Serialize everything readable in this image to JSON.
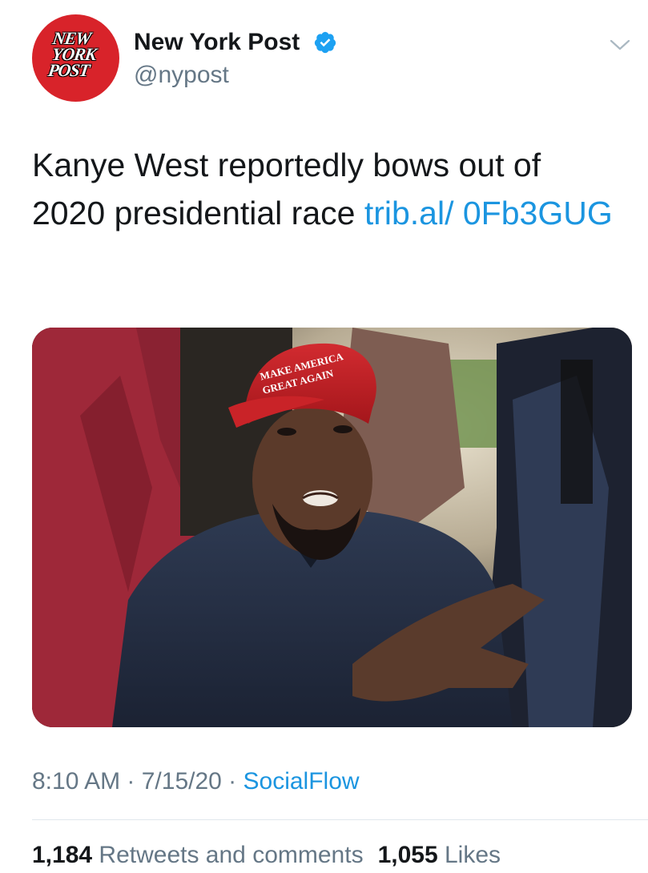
{
  "account": {
    "logo_lines": [
      "NEW",
      "YORK",
      "POST"
    ],
    "display_name": "New York Post",
    "handle": "@nypost",
    "verified": true,
    "verified_icon": "verified-badge-icon",
    "menu_icon": "chevron-down-icon",
    "brand_color": "#d8232a"
  },
  "tweet": {
    "text": "Kanye West reportedly bows out of 2020 presidential race ",
    "link": "trib.al/ 0Fb3GUG",
    "link_color": "#1b95e0"
  },
  "media": {
    "hat_text_1": "MAKE AMERICA",
    "hat_text_2": "GREAT AGAIN"
  },
  "meta": {
    "time": "8:10 AM",
    "sep1": " · ",
    "date": "7/15/20",
    "sep2": " · ",
    "source": "SocialFlow"
  },
  "stats": {
    "retweets_count": "1,184",
    "retweets_label": "Retweets and comments",
    "likes_count": "1,055",
    "likes_label": "Likes"
  }
}
